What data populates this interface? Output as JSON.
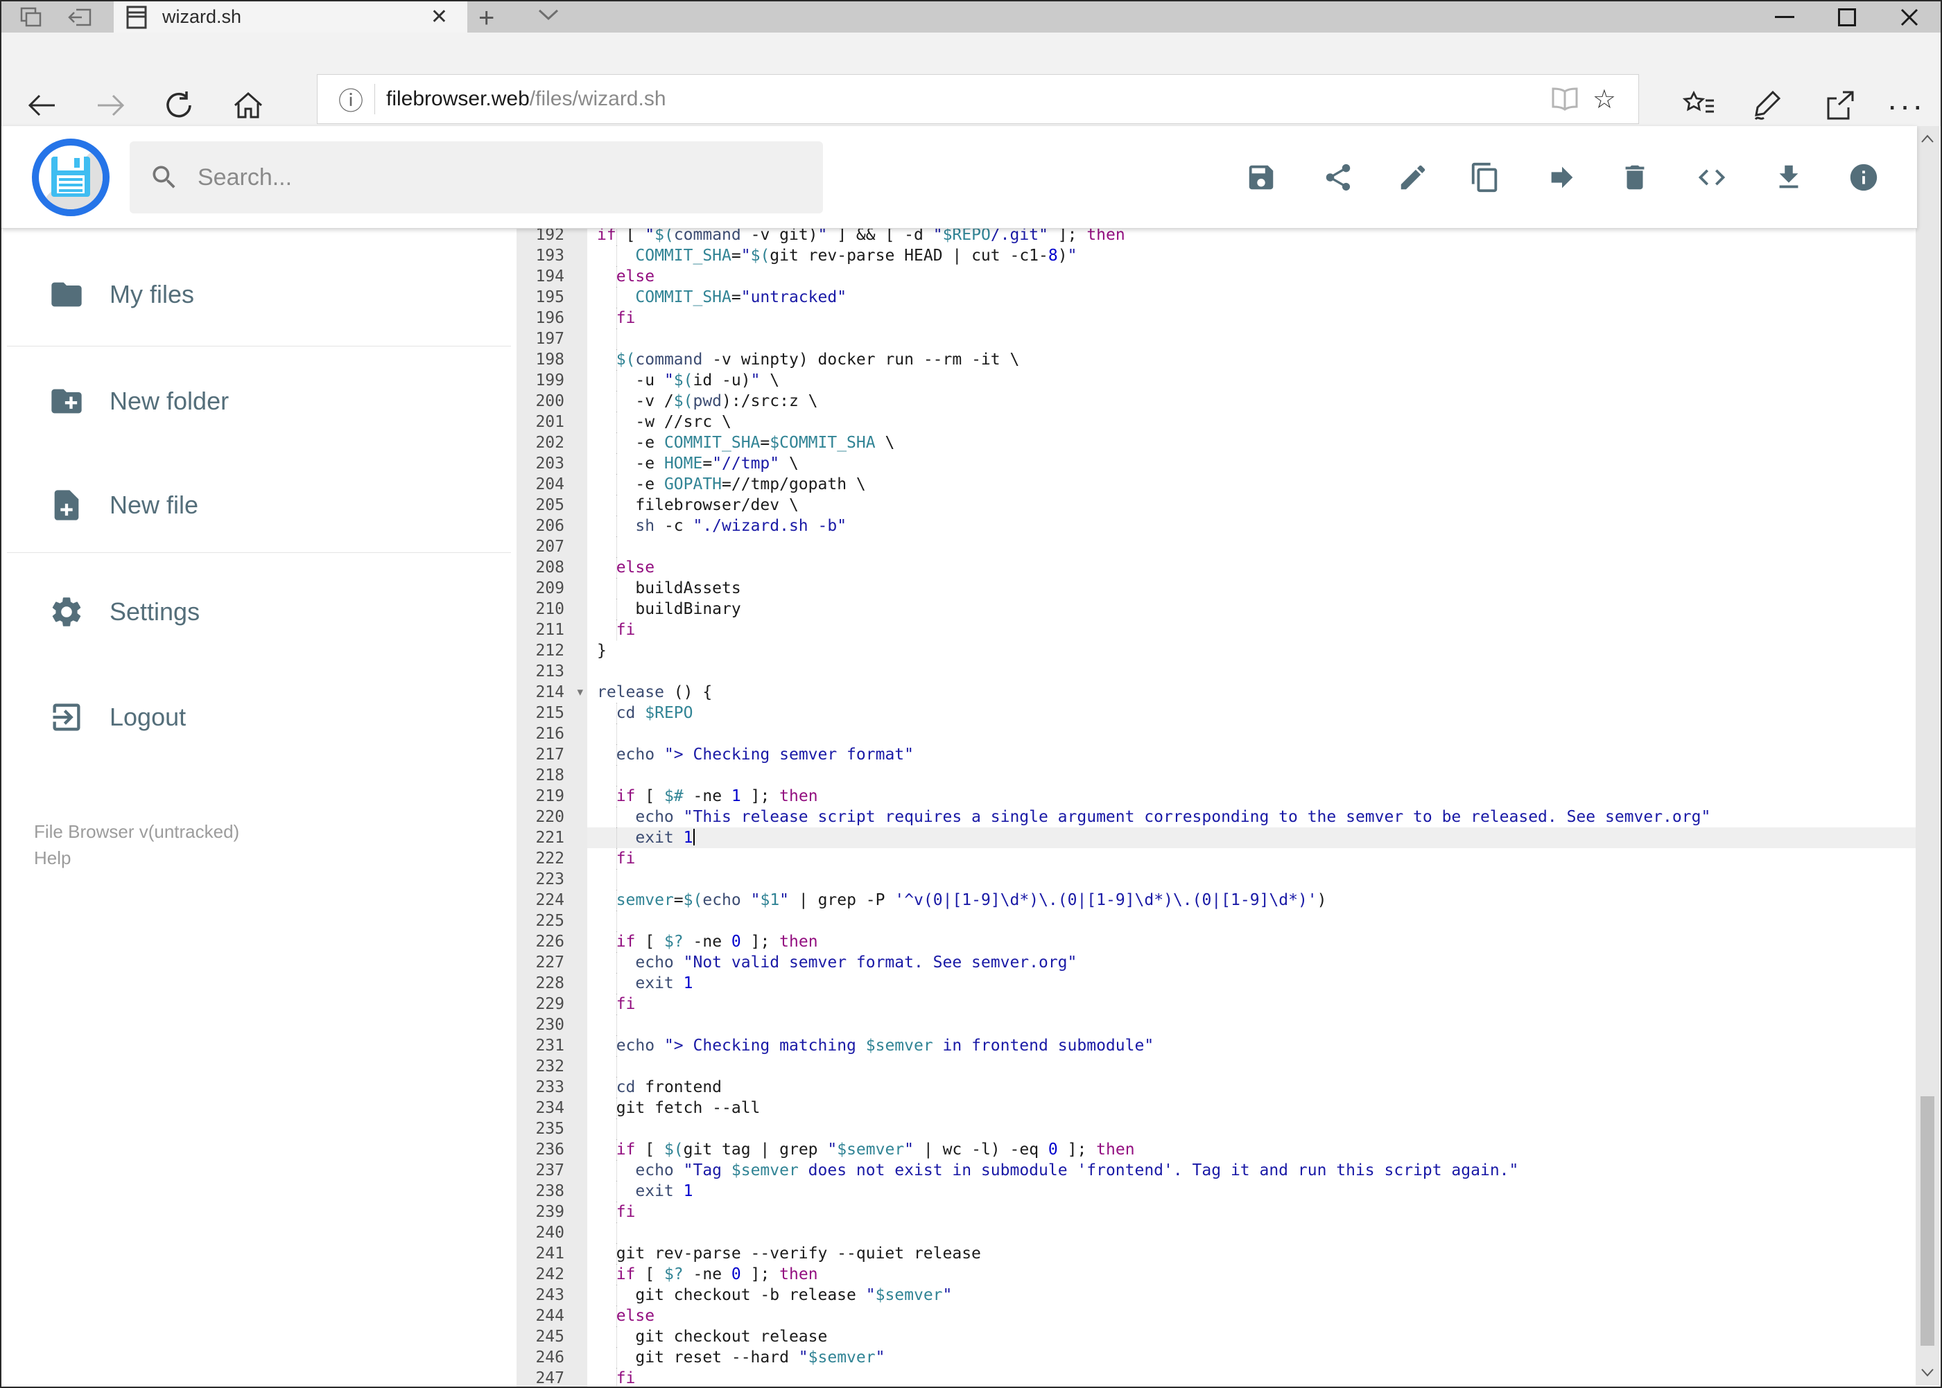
{
  "browser": {
    "tab_title": "wizard.sh",
    "new_tab_label": "+",
    "close_tab_label": "×",
    "url_host": "filebrowser.web",
    "url_path": "/files/wizard.sh",
    "info_glyph": "ⓘ",
    "star_glyph": "☆",
    "ellipsis_glyph": "···",
    "minimize_glyph": "—",
    "maximize_glyph": "□",
    "close_glyph": "✕"
  },
  "header": {
    "search_placeholder": "Search...",
    "toolbar": [
      {
        "name": "save"
      },
      {
        "name": "share"
      },
      {
        "name": "edit"
      },
      {
        "name": "copy"
      },
      {
        "name": "move"
      },
      {
        "name": "delete"
      },
      {
        "name": "code"
      },
      {
        "name": "download"
      },
      {
        "name": "info"
      }
    ]
  },
  "sidebar": {
    "items": [
      {
        "label": "My files"
      },
      {
        "label": "New folder"
      },
      {
        "label": "New file"
      },
      {
        "label": "Settings"
      },
      {
        "label": "Logout"
      }
    ],
    "footer_version": "File Browser v(untracked)",
    "footer_help": "Help"
  },
  "colors": {
    "accent_blue": "#2574e8",
    "slate_icon": "#546e7a",
    "tk_keyword": "#930f80",
    "tk_builtin": "#3c4c72",
    "tk_variable": "#318495",
    "tk_string": "#1a1aa6",
    "tk_number": "#0000cd"
  },
  "editor": {
    "active_line": 221,
    "fold_line": 214,
    "lines": [
      {
        "n": 192,
        "g": 1,
        "s": [
          [
            "if",
            "k"
          ],
          [
            " [ ",
            "t"
          ],
          [
            "\"",
            "s"
          ],
          [
            "$(",
            "v"
          ],
          [
            "command",
            "b"
          ],
          [
            " -v git)",
            "t"
          ],
          [
            "\"",
            "s"
          ],
          [
            " ] && [ -d ",
            "t"
          ],
          [
            "\"",
            "s"
          ],
          [
            "$REPO",
            "v"
          ],
          [
            "/.git\"",
            "s"
          ],
          [
            " ]; ",
            "t"
          ],
          [
            "then",
            "k"
          ]
        ]
      },
      {
        "n": 193,
        "g": 1,
        "s": [
          [
            "    ",
            "t"
          ],
          [
            "COMMIT_SHA",
            "v"
          ],
          [
            "=",
            "t"
          ],
          [
            "\"",
            "s"
          ],
          [
            "$(",
            "v"
          ],
          [
            "git rev-parse HEAD | cut -c1-",
            "t"
          ],
          [
            "8",
            "n"
          ],
          [
            ")",
            "t"
          ],
          [
            "\"",
            "s"
          ]
        ]
      },
      {
        "n": 194,
        "g": 1,
        "s": [
          [
            "  ",
            "t"
          ],
          [
            "else",
            "k"
          ]
        ]
      },
      {
        "n": 195,
        "g": 1,
        "s": [
          [
            "    ",
            "t"
          ],
          [
            "COMMIT_SHA",
            "v"
          ],
          [
            "=",
            "t"
          ],
          [
            "\"untracked\"",
            "s"
          ]
        ]
      },
      {
        "n": 196,
        "g": 1,
        "s": [
          [
            "  ",
            "t"
          ],
          [
            "fi",
            "k"
          ]
        ]
      },
      {
        "n": 197,
        "g": 1,
        "s": []
      },
      {
        "n": 198,
        "g": 1,
        "s": [
          [
            "  ",
            "t"
          ],
          [
            "$(",
            "v"
          ],
          [
            "command",
            "b"
          ],
          [
            " -v winpty) docker run --rm -it \\",
            "t"
          ]
        ]
      },
      {
        "n": 199,
        "g": 1,
        "s": [
          [
            "    -u ",
            "t"
          ],
          [
            "\"",
            "s"
          ],
          [
            "$(",
            "v"
          ],
          [
            "id -u)",
            "t"
          ],
          [
            "\"",
            "s"
          ],
          [
            " \\",
            "t"
          ]
        ]
      },
      {
        "n": 200,
        "g": 1,
        "s": [
          [
            "    -v /",
            "t"
          ],
          [
            "$(",
            "v"
          ],
          [
            "pwd",
            "b"
          ],
          [
            ")",
            "t"
          ],
          [
            ":/src:z \\",
            "t"
          ]
        ]
      },
      {
        "n": 201,
        "g": 1,
        "s": [
          [
            "    -w //src \\",
            "t"
          ]
        ]
      },
      {
        "n": 202,
        "g": 1,
        "s": [
          [
            "    -e ",
            "t"
          ],
          [
            "COMMIT_SHA",
            "v"
          ],
          [
            "=",
            "t"
          ],
          [
            "$COMMIT_SHA",
            "v"
          ],
          [
            " \\",
            "t"
          ]
        ]
      },
      {
        "n": 203,
        "g": 1,
        "s": [
          [
            "    -e ",
            "t"
          ],
          [
            "HOME",
            "v"
          ],
          [
            "=",
            "t"
          ],
          [
            "\"//tmp\"",
            "s"
          ],
          [
            " \\",
            "t"
          ]
        ]
      },
      {
        "n": 204,
        "g": 1,
        "s": [
          [
            "    -e ",
            "t"
          ],
          [
            "GOPATH",
            "v"
          ],
          [
            "=//tmp/gopath \\",
            "t"
          ]
        ]
      },
      {
        "n": 205,
        "g": 1,
        "s": [
          [
            "    filebrowser/dev \\",
            "t"
          ]
        ]
      },
      {
        "n": 206,
        "g": 1,
        "s": [
          [
            "    ",
            "t"
          ],
          [
            "sh",
            "b"
          ],
          [
            " -c ",
            "t"
          ],
          [
            "\"./wizard.sh -b\"",
            "s"
          ]
        ]
      },
      {
        "n": 207,
        "g": 1,
        "s": []
      },
      {
        "n": 208,
        "g": 1,
        "s": [
          [
            "  ",
            "t"
          ],
          [
            "else",
            "k"
          ]
        ]
      },
      {
        "n": 209,
        "g": 1,
        "s": [
          [
            "    buildAssets",
            "t"
          ]
        ]
      },
      {
        "n": 210,
        "g": 1,
        "s": [
          [
            "    buildBinary",
            "t"
          ]
        ]
      },
      {
        "n": 211,
        "g": 1,
        "s": [
          [
            "  ",
            "t"
          ],
          [
            "fi",
            "k"
          ]
        ]
      },
      {
        "n": 212,
        "g": 0,
        "s": [
          [
            "}",
            "t"
          ]
        ]
      },
      {
        "n": 213,
        "g": 0,
        "s": []
      },
      {
        "n": 214,
        "g": 0,
        "s": [
          [
            "release",
            "b"
          ],
          [
            " () {",
            "t"
          ]
        ]
      },
      {
        "n": 215,
        "g": 1,
        "s": [
          [
            "  ",
            "t"
          ],
          [
            "cd",
            "b"
          ],
          [
            " ",
            "t"
          ],
          [
            "$REPO",
            "v"
          ]
        ]
      },
      {
        "n": 216,
        "g": 1,
        "s": []
      },
      {
        "n": 217,
        "g": 1,
        "s": [
          [
            "  ",
            "t"
          ],
          [
            "echo",
            "b"
          ],
          [
            " ",
            "t"
          ],
          [
            "\"> Checking semver format\"",
            "s"
          ]
        ]
      },
      {
        "n": 218,
        "g": 1,
        "s": []
      },
      {
        "n": 219,
        "g": 1,
        "s": [
          [
            "  ",
            "t"
          ],
          [
            "if",
            "k"
          ],
          [
            " [ ",
            "t"
          ],
          [
            "$#",
            "v"
          ],
          [
            " -ne ",
            "t"
          ],
          [
            "1",
            "n"
          ],
          [
            " ]; ",
            "t"
          ],
          [
            "then",
            "k"
          ]
        ]
      },
      {
        "n": 220,
        "g": 1,
        "s": [
          [
            "    ",
            "t"
          ],
          [
            "echo",
            "b"
          ],
          [
            " ",
            "t"
          ],
          [
            "\"This release script requires a single argument corresponding to the semver to be released. See semver.org\"",
            "s"
          ]
        ]
      },
      {
        "n": 221,
        "g": 1,
        "s": [
          [
            "    ",
            "t"
          ],
          [
            "exit",
            "b"
          ],
          [
            " ",
            "t"
          ],
          [
            "1",
            "n"
          ]
        ]
      },
      {
        "n": 222,
        "g": 1,
        "s": [
          [
            "  ",
            "t"
          ],
          [
            "fi",
            "k"
          ]
        ]
      },
      {
        "n": 223,
        "g": 1,
        "s": []
      },
      {
        "n": 224,
        "g": 1,
        "s": [
          [
            "  ",
            "t"
          ],
          [
            "semver",
            "v"
          ],
          [
            "=",
            "t"
          ],
          [
            "$(",
            "v"
          ],
          [
            "echo",
            "b"
          ],
          [
            " ",
            "t"
          ],
          [
            "\"",
            "s"
          ],
          [
            "$1",
            "v"
          ],
          [
            "\"",
            "s"
          ],
          [
            " | grep -P ",
            "t"
          ],
          [
            "'^v(0|[1-9]\\d*)\\.(0|[1-9]\\d*)\\.(0|[1-9]\\d*)'",
            "s"
          ],
          [
            ")",
            "t"
          ]
        ]
      },
      {
        "n": 225,
        "g": 1,
        "s": []
      },
      {
        "n": 226,
        "g": 1,
        "s": [
          [
            "  ",
            "t"
          ],
          [
            "if",
            "k"
          ],
          [
            " [ ",
            "t"
          ],
          [
            "$?",
            "v"
          ],
          [
            " -ne ",
            "t"
          ],
          [
            "0",
            "n"
          ],
          [
            " ]; ",
            "t"
          ],
          [
            "then",
            "k"
          ]
        ]
      },
      {
        "n": 227,
        "g": 1,
        "s": [
          [
            "    ",
            "t"
          ],
          [
            "echo",
            "b"
          ],
          [
            " ",
            "t"
          ],
          [
            "\"Not valid semver format. See semver.org\"",
            "s"
          ]
        ]
      },
      {
        "n": 228,
        "g": 1,
        "s": [
          [
            "    ",
            "t"
          ],
          [
            "exit",
            "b"
          ],
          [
            " ",
            "t"
          ],
          [
            "1",
            "n"
          ]
        ]
      },
      {
        "n": 229,
        "g": 1,
        "s": [
          [
            "  ",
            "t"
          ],
          [
            "fi",
            "k"
          ]
        ]
      },
      {
        "n": 230,
        "g": 1,
        "s": []
      },
      {
        "n": 231,
        "g": 1,
        "s": [
          [
            "  ",
            "t"
          ],
          [
            "echo",
            "b"
          ],
          [
            " ",
            "t"
          ],
          [
            "\"> Checking matching ",
            "s"
          ],
          [
            "$semver",
            "v"
          ],
          [
            " in frontend submodule\"",
            "s"
          ]
        ]
      },
      {
        "n": 232,
        "g": 1,
        "s": []
      },
      {
        "n": 233,
        "g": 1,
        "s": [
          [
            "  ",
            "t"
          ],
          [
            "cd",
            "b"
          ],
          [
            " frontend",
            "t"
          ]
        ]
      },
      {
        "n": 234,
        "g": 1,
        "s": [
          [
            "  git fetch --all",
            "t"
          ]
        ]
      },
      {
        "n": 235,
        "g": 1,
        "s": []
      },
      {
        "n": 236,
        "g": 1,
        "s": [
          [
            "  ",
            "t"
          ],
          [
            "if",
            "k"
          ],
          [
            " [ ",
            "t"
          ],
          [
            "$(",
            "v"
          ],
          [
            "git tag | grep ",
            "t"
          ],
          [
            "\"",
            "s"
          ],
          [
            "$semver",
            "v"
          ],
          [
            "\"",
            "s"
          ],
          [
            " | wc -l) -eq ",
            "t"
          ],
          [
            "0",
            "n"
          ],
          [
            " ]; ",
            "t"
          ],
          [
            "then",
            "k"
          ]
        ]
      },
      {
        "n": 237,
        "g": 1,
        "s": [
          [
            "    ",
            "t"
          ],
          [
            "echo",
            "b"
          ],
          [
            " ",
            "t"
          ],
          [
            "\"Tag ",
            "s"
          ],
          [
            "$semver",
            "v"
          ],
          [
            " does not exist in submodule 'frontend'. Tag it and run this script again.\"",
            "s"
          ]
        ]
      },
      {
        "n": 238,
        "g": 1,
        "s": [
          [
            "    ",
            "t"
          ],
          [
            "exit",
            "b"
          ],
          [
            " ",
            "t"
          ],
          [
            "1",
            "n"
          ]
        ]
      },
      {
        "n": 239,
        "g": 1,
        "s": [
          [
            "  ",
            "t"
          ],
          [
            "fi",
            "k"
          ]
        ]
      },
      {
        "n": 240,
        "g": 1,
        "s": []
      },
      {
        "n": 241,
        "g": 1,
        "s": [
          [
            "  git rev-parse --verify --quiet release",
            "t"
          ]
        ]
      },
      {
        "n": 242,
        "g": 1,
        "s": [
          [
            "  ",
            "t"
          ],
          [
            "if",
            "k"
          ],
          [
            " [ ",
            "t"
          ],
          [
            "$?",
            "v"
          ],
          [
            " -ne ",
            "t"
          ],
          [
            "0",
            "n"
          ],
          [
            " ]; ",
            "t"
          ],
          [
            "then",
            "k"
          ]
        ]
      },
      {
        "n": 243,
        "g": 1,
        "s": [
          [
            "    git checkout -b release ",
            "t"
          ],
          [
            "\"",
            "s"
          ],
          [
            "$semver",
            "v"
          ],
          [
            "\"",
            "s"
          ]
        ]
      },
      {
        "n": 244,
        "g": 1,
        "s": [
          [
            "  ",
            "t"
          ],
          [
            "else",
            "k"
          ]
        ]
      },
      {
        "n": 245,
        "g": 1,
        "s": [
          [
            "    git checkout release",
            "t"
          ]
        ]
      },
      {
        "n": 246,
        "g": 1,
        "s": [
          [
            "    git reset --hard ",
            "t"
          ],
          [
            "\"",
            "s"
          ],
          [
            "$semver",
            "v"
          ],
          [
            "\"",
            "s"
          ]
        ]
      },
      {
        "n": 247,
        "g": 1,
        "s": [
          [
            "  ",
            "t"
          ],
          [
            "fi",
            "k"
          ]
        ]
      }
    ]
  }
}
